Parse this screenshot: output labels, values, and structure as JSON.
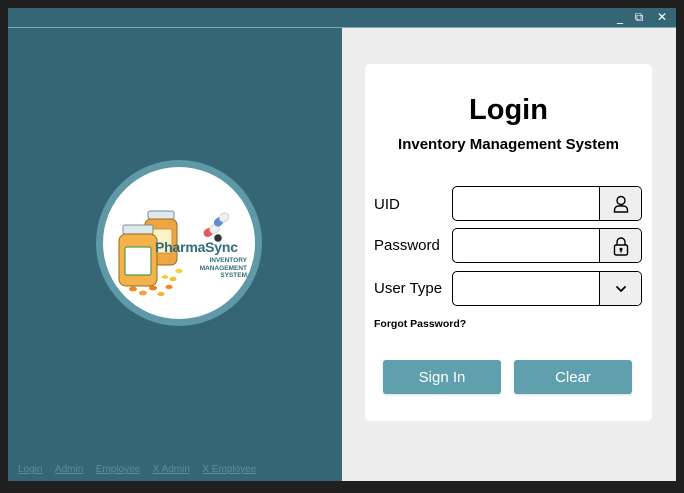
{
  "window": {
    "controls": {
      "minimize": "_",
      "maximize": "⧉",
      "close": "✕"
    }
  },
  "brand": {
    "name": "PharmaSync",
    "tagline": [
      "INVENTORY",
      "MANAGEMENT",
      "SYSTEM"
    ]
  },
  "footer_links": [
    "Login",
    "Admin",
    "Employee",
    "X Admin",
    "X Employee"
  ],
  "login_card": {
    "title": "Login",
    "subtitle": "Inventory Management System",
    "fields": {
      "uid": {
        "label": "UID",
        "value": "",
        "icon": "user-icon"
      },
      "password": {
        "label": "Password",
        "value": "",
        "icon": "lock-icon"
      },
      "user_type": {
        "label": "User Type",
        "value": "",
        "icon": "chevron-down-icon"
      }
    },
    "forgot_password": "Forgot Password?",
    "sign_in": "Sign In",
    "clear": "Clear"
  },
  "colors": {
    "sidebar": "#356676",
    "accent_button": "#5f9fae",
    "logo_ring": "#5f99a8",
    "brand_text": "#2f6d7a"
  }
}
